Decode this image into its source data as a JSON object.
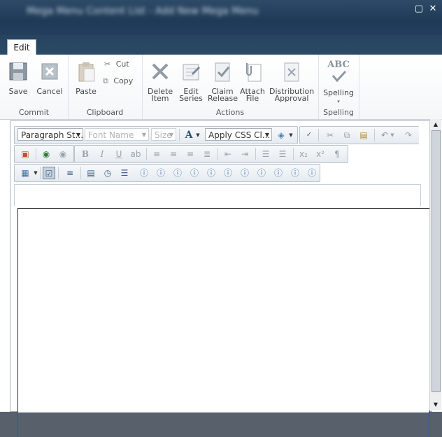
{
  "window": {
    "title": "Mega Menu Content List - Add New Mega Menu",
    "maximize_icon": "maximize-icon",
    "close_icon": "close-icon"
  },
  "ribbon": {
    "tabs": [
      {
        "label": "Edit",
        "active": true
      }
    ],
    "groups": {
      "commit": {
        "label": "Commit",
        "save": "Save",
        "cancel": "Cancel"
      },
      "clipboard": {
        "label": "Clipboard",
        "paste": "Paste",
        "cut": "Cut",
        "copy": "Copy"
      },
      "actions": {
        "label": "Actions",
        "delete_1": "Delete",
        "delete_2": "Item",
        "edit_1": "Edit",
        "edit_2": "Series",
        "claim_1": "Claim",
        "claim_2": "Release",
        "attach_1": "Attach",
        "attach_2": "File",
        "dist_1": "Distribution",
        "dist_2": "Approval"
      },
      "spelling": {
        "label": "Spelling",
        "button": "Spelling",
        "abc": "ABC"
      }
    }
  },
  "editor_toolbar": {
    "paragraph_style": "Paragraph St...",
    "font_name": "Font Name",
    "font_size": "Size",
    "font_color_glyph": "A",
    "apply_css": "Apply CSS Cl...",
    "format_glyphs": {
      "bold": "B",
      "italic": "I",
      "underline": "U"
    }
  },
  "colors": {
    "title_bar": "#1f3a57",
    "ribbon_bg": "#f4f6f8",
    "toolbar_bg": "#e6ebf0",
    "status_gray": "#57606b",
    "guide_blue": "#3050d0"
  }
}
